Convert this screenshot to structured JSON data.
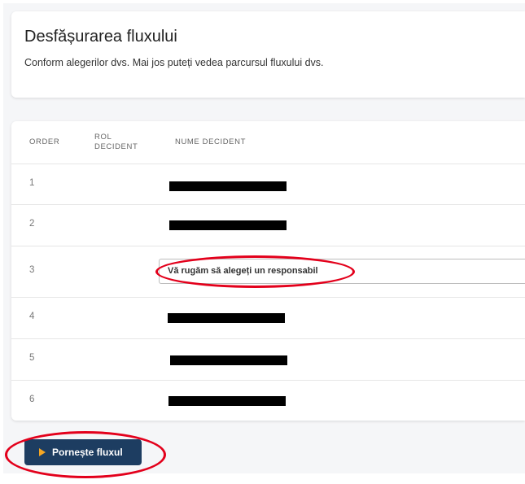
{
  "header": {
    "title": "Desfășurarea fluxului",
    "subtitle": "Conform alegerilor dvs. Mai jos puteți vedea parcursul fluxului dvs."
  },
  "table": {
    "columns": [
      "ORDER",
      "ROL DECIDENT",
      "NUME DECIDENT"
    ],
    "rows": [
      {
        "order": "1"
      },
      {
        "order": "2"
      },
      {
        "order": "3",
        "select_placeholder": "Vă rugăm să alegeți un responsabil"
      },
      {
        "order": "4"
      },
      {
        "order": "5"
      },
      {
        "order": "6"
      }
    ]
  },
  "actions": {
    "start_label": "Pornește fluxul"
  },
  "colors": {
    "primary_button": "#1d3d61",
    "play_icon": "#f5a623",
    "highlight": "#e3001b"
  },
  "icons": {
    "start": "play-icon"
  }
}
